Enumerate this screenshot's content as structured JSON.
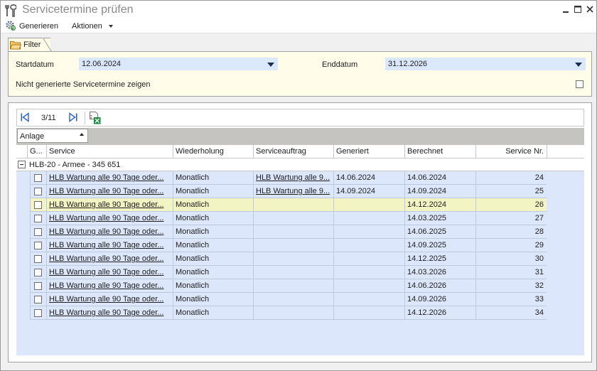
{
  "window": {
    "title": "Servicetermine prüfen"
  },
  "menu": {
    "generate_label": "Generieren",
    "actions_label": "Aktionen"
  },
  "filter": {
    "tab_label": "Filter",
    "start_label": "Startdatum",
    "start_value": "12.06.2024",
    "end_label": "Enddatum",
    "end_value": "31.12.2026",
    "show_ungenerated_label": "Nicht generierte Servicetermine zeigen",
    "show_ungenerated_checked": false
  },
  "navigator": {
    "page": "3/11"
  },
  "grouping": {
    "group_by": "Anlage"
  },
  "grid": {
    "columns": [
      "G...",
      "Service",
      "Wiederholung",
      "Serviceauftrag",
      "Generiert",
      "Berechnet",
      "Service Nr."
    ],
    "group": "HLB-20 - Armee - 345 651",
    "rows": [
      {
        "service": "HLB Wartung alle 90 Tage oder...",
        "repeat": "Monatlich",
        "order": "HLB Wartung alle 9...",
        "generated": "14.06.2024",
        "calculated": "14.06.2024",
        "nr": "24"
      },
      {
        "service": "HLB Wartung alle 90 Tage oder...",
        "repeat": "Monatlich",
        "order": "HLB Wartung alle 9...",
        "generated": "14.09.2024",
        "calculated": "14.09.2024",
        "nr": "25"
      },
      {
        "service": "HLB Wartung alle 90 Tage oder...",
        "repeat": "Monatlich",
        "order": "",
        "generated": "",
        "calculated": "14.12.2024",
        "nr": "26"
      },
      {
        "service": "HLB Wartung alle 90 Tage oder...",
        "repeat": "Monatlich",
        "order": "",
        "generated": "",
        "calculated": "14.03.2025",
        "nr": "27"
      },
      {
        "service": "HLB Wartung alle 90 Tage oder...",
        "repeat": "Monatlich",
        "order": "",
        "generated": "",
        "calculated": "14.06.2025",
        "nr": "28"
      },
      {
        "service": "HLB Wartung alle 90 Tage oder...",
        "repeat": "Monatlich",
        "order": "",
        "generated": "",
        "calculated": "14.09.2025",
        "nr": "29"
      },
      {
        "service": "HLB Wartung alle 90 Tage oder...",
        "repeat": "Monatlich",
        "order": "",
        "generated": "",
        "calculated": "14.12.2025",
        "nr": "30"
      },
      {
        "service": "HLB Wartung alle 90 Tage oder...",
        "repeat": "Monatlich",
        "order": "",
        "generated": "",
        "calculated": "14.03.2026",
        "nr": "31"
      },
      {
        "service": "HLB Wartung alle 90 Tage oder...",
        "repeat": "Monatlich",
        "order": "",
        "generated": "",
        "calculated": "14.06.2026",
        "nr": "32"
      },
      {
        "service": "HLB Wartung alle 90 Tage oder...",
        "repeat": "Monatlich",
        "order": "",
        "generated": "",
        "calculated": "14.09.2026",
        "nr": "33"
      },
      {
        "service": "HLB Wartung alle 90 Tage oder...",
        "repeat": "Monatlich",
        "order": "",
        "generated": "",
        "calculated": "14.12.2026",
        "nr": "34"
      }
    ],
    "selected_row_index": 2
  },
  "colors": {
    "row_bg": "#dce7fb",
    "selected_row_bg": "#f3f4c4",
    "filter_bg": "#fffcea",
    "combo_bg": "#dbe7fb"
  }
}
